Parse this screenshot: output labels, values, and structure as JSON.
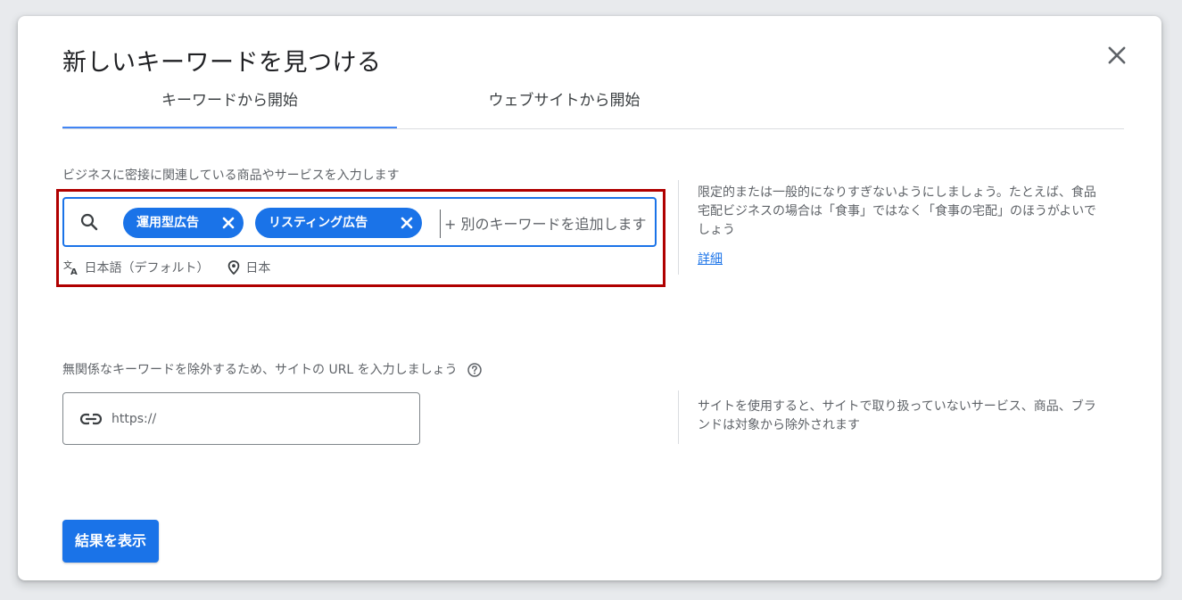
{
  "dialog": {
    "title": "新しいキーワードを見つける",
    "close_icon": "close-icon"
  },
  "tabs": [
    {
      "label": "キーワードから開始",
      "active": true
    },
    {
      "label": "ウェブサイトから開始",
      "active": false
    }
  ],
  "keywords": {
    "label": "ビジネスに密接に関連している商品やサービスを入力します",
    "chips": [
      "運用型広告",
      "リスティング広告"
    ],
    "placeholder": "+ 別のキーワードを追加します",
    "language": "日本語（デフォルト）",
    "location": "日本",
    "help_text": "限定的または一般的になりすぎないようにしましょう。たとえば、食品宅配ビジネスの場合は「食事」ではなく「食事の宅配」のほうがよいでしょう",
    "detail_link": "詳細"
  },
  "url": {
    "label": "無関係なキーワードを除外するため、サイトの URL を入力しましょう",
    "placeholder": "https://",
    "help_text": "サイトを使用すると、サイトで取り扱っていないサービス、商品、ブランドは対象から除外されます"
  },
  "submit_label": "結果を表示",
  "colors": {
    "accent": "#1a73e8",
    "highlight_box": "#b00000"
  }
}
